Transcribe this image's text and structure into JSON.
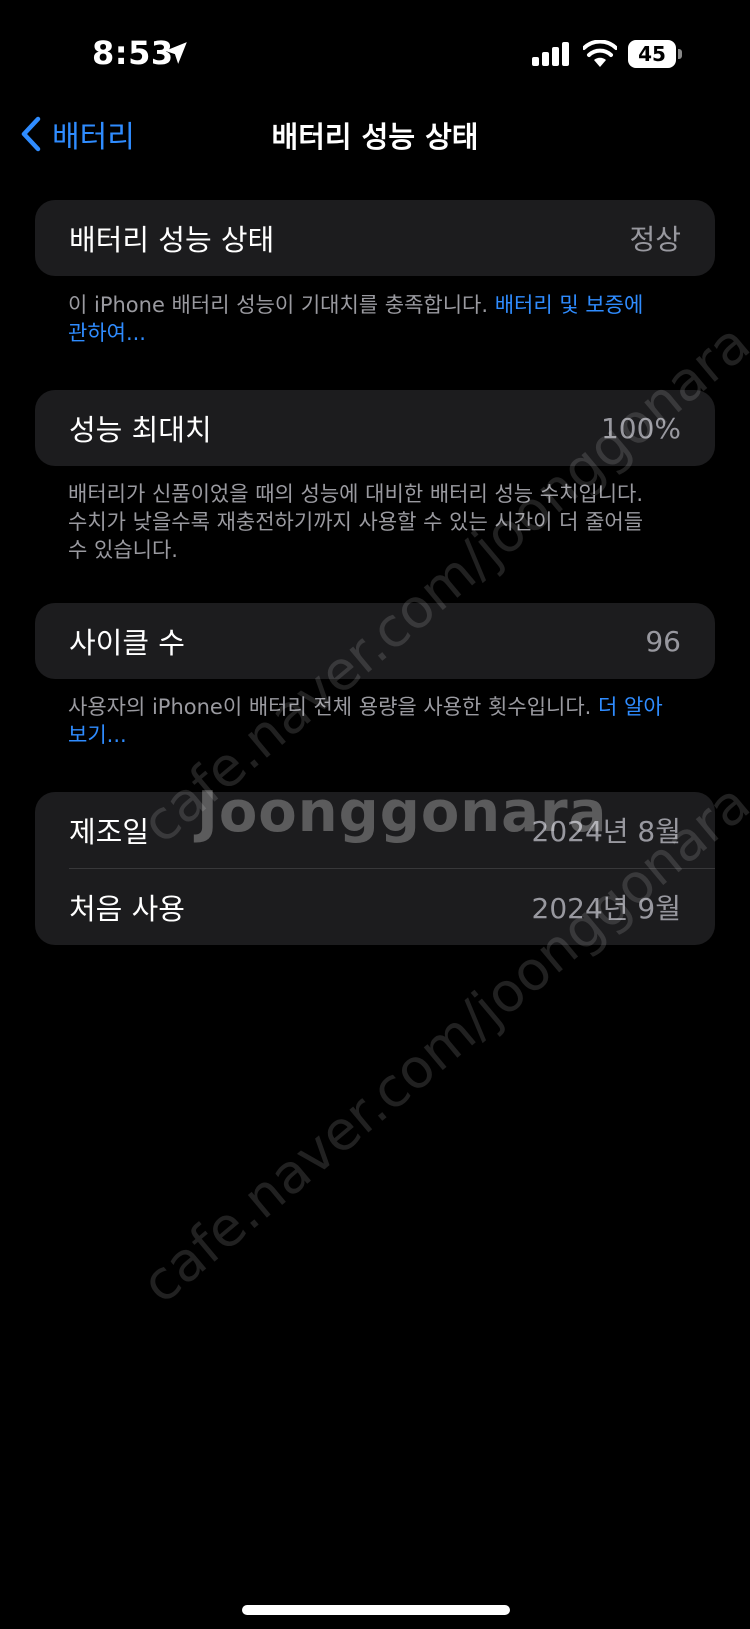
{
  "status_bar": {
    "time": "8:53",
    "battery_level": "45"
  },
  "nav": {
    "back_label": "배터리",
    "title": "배터리 성능 상태"
  },
  "health": {
    "label": "배터리 성능 상태",
    "value": "정상",
    "note_text": "이 iPhone 배터리 성능이 기대치를 충족합니다. ",
    "note_link": "배터리 및 보증에 관하여..."
  },
  "max_capacity": {
    "label": "성능 최대치",
    "value": "100%",
    "note_text": "배터리가 신품이었을 때의 성능에 대비한 배터리 성능 수치입니다. 수치가 낮을수록 재충전하기까지 사용할 수 있는 시간이 더 줄어들 수 있습니다."
  },
  "cycle_count": {
    "label": "사이클 수",
    "value": "96",
    "note_text": "사용자의 iPhone이 배터리 전체 용량을 사용한 횟수입니다. ",
    "note_link": "더 알아보기..."
  },
  "dates": {
    "manufacture_label": "제조일",
    "manufacture_value": "2024년 8월",
    "first_use_label": "처음 사용",
    "first_use_value": "2024년 9월"
  },
  "watermark": {
    "logo": "Joonggonara",
    "url": "cafe.naver.com/joonggonara"
  },
  "colors": {
    "accent": "#2f8cff",
    "background": "#000000",
    "card": "#1c1c1e"
  }
}
